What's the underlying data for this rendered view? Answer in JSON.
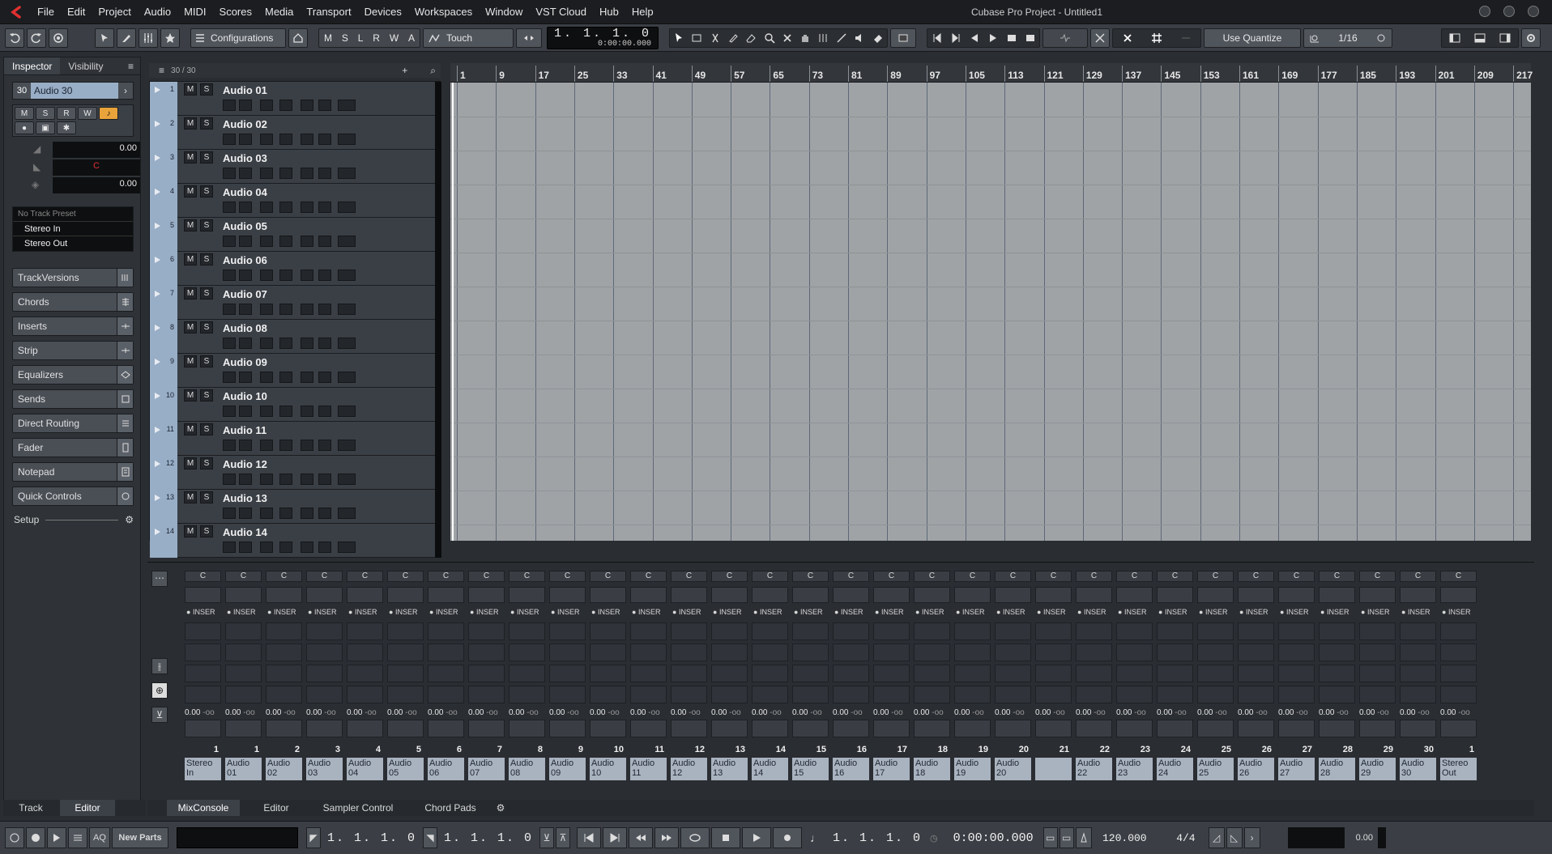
{
  "window": {
    "title": "Cubase Pro Project - Untitled1"
  },
  "menu": [
    "File",
    "Edit",
    "Project",
    "Audio",
    "MIDI",
    "Scores",
    "Media",
    "Transport",
    "Devices",
    "Workspaces",
    "Window",
    "VST Cloud",
    "Hub",
    "Help"
  ],
  "toolbar": {
    "configurations_label": "Configurations",
    "automation_mode": "Touch",
    "position_bars": "1. 1. 1.  0",
    "position_time": "0:00:00.000",
    "quantize_mode": "Use Quantize",
    "quantize_value": "1/16",
    "mute_letters": [
      "M",
      "S",
      "L",
      "R",
      "W",
      "A"
    ]
  },
  "inspector": {
    "tabs": [
      "Inspector",
      "Visibility"
    ],
    "track_number": "30",
    "track_name": "Audio 30",
    "volume": "0.00",
    "pan": "C",
    "delay": "0.00",
    "preset": "No Track Preset",
    "input": "Stereo In",
    "output": "Stereo Out",
    "sections": [
      "TrackVersions",
      "Chords",
      "Inserts",
      "Strip",
      "Equalizers",
      "Sends",
      "Direct Routing",
      "Fader",
      "Notepad",
      "Quick Controls"
    ],
    "setup_label": "Setup",
    "bottom_tabs": [
      "Track",
      "Editor"
    ]
  },
  "tracklist": {
    "count_label": "30 / 30",
    "tracks": [
      {
        "num": "1",
        "name": "Audio 01"
      },
      {
        "num": "2",
        "name": "Audio 02"
      },
      {
        "num": "3",
        "name": "Audio 03"
      },
      {
        "num": "4",
        "name": "Audio 04"
      },
      {
        "num": "5",
        "name": "Audio 05"
      },
      {
        "num": "6",
        "name": "Audio 06"
      },
      {
        "num": "7",
        "name": "Audio 07"
      },
      {
        "num": "8",
        "name": "Audio 08"
      },
      {
        "num": "9",
        "name": "Audio 09"
      },
      {
        "num": "10",
        "name": "Audio 10"
      },
      {
        "num": "11",
        "name": "Audio 11"
      },
      {
        "num": "12",
        "name": "Audio 12"
      },
      {
        "num": "13",
        "name": "Audio 13"
      },
      {
        "num": "14",
        "name": "Audio 14"
      }
    ]
  },
  "ruler": [
    "1",
    "9",
    "17",
    "25",
    "33",
    "41",
    "49",
    "57",
    "65",
    "73",
    "81",
    "89",
    "97",
    "105",
    "113",
    "121",
    "129",
    "137",
    "145",
    "153",
    "161",
    "169",
    "177",
    "185",
    "193",
    "201",
    "209",
    "217"
  ],
  "mixer": {
    "insert_label": "INSER",
    "fader_value": "0.00",
    "fader_db": "-oo",
    "pan_label": "C",
    "strips": [
      {
        "num": "1",
        "name": "Stereo In"
      },
      {
        "num": "1",
        "name": "Audio 01"
      },
      {
        "num": "2",
        "name": "Audio 02"
      },
      {
        "num": "3",
        "name": "Audio 03"
      },
      {
        "num": "4",
        "name": "Audio 04"
      },
      {
        "num": "5",
        "name": "Audio 05"
      },
      {
        "num": "6",
        "name": "Audio 06"
      },
      {
        "num": "7",
        "name": "Audio 07"
      },
      {
        "num": "8",
        "name": "Audio 08"
      },
      {
        "num": "9",
        "name": "Audio 09"
      },
      {
        "num": "10",
        "name": "Audio 10"
      },
      {
        "num": "11",
        "name": "Audio 11"
      },
      {
        "num": "12",
        "name": "Audio 12"
      },
      {
        "num": "13",
        "name": "Audio 13"
      },
      {
        "num": "14",
        "name": "Audio 14"
      },
      {
        "num": "15",
        "name": "Audio 15"
      },
      {
        "num": "16",
        "name": "Audio 16"
      },
      {
        "num": "17",
        "name": "Audio 17"
      },
      {
        "num": "18",
        "name": "Audio 18"
      },
      {
        "num": "19",
        "name": "Audio 19"
      },
      {
        "num": "20",
        "name": "Audio 20"
      },
      {
        "num": "21",
        "name": ""
      },
      {
        "num": "22",
        "name": "Audio 22"
      },
      {
        "num": "23",
        "name": "Audio 23"
      },
      {
        "num": "24",
        "name": "Audio 24"
      },
      {
        "num": "25",
        "name": "Audio 25"
      },
      {
        "num": "26",
        "name": "Audio 26"
      },
      {
        "num": "27",
        "name": "Audio 27"
      },
      {
        "num": "28",
        "name": "Audio 28"
      },
      {
        "num": "29",
        "name": "Audio 29"
      },
      {
        "num": "30",
        "name": "Audio 30"
      },
      {
        "num": "1",
        "name": "Stereo Out"
      }
    ]
  },
  "lower_tabs": [
    "MixConsole",
    "Editor",
    "Sampler Control",
    "Chord Pads"
  ],
  "transport": {
    "aq_label": "AQ",
    "new_parts": "New Parts",
    "left_locator": "1. 1. 1.  0",
    "right_locator": "1. 1. 1.  0",
    "primary_position": "1. 1. 1.  0",
    "secondary_position": "0:00:00.000",
    "tempo": "120.000",
    "signature": "4/4",
    "output_level": "0.00"
  },
  "colors": {
    "track_number_bg": "#98aec6",
    "accent": "#e8a33a",
    "arrange_bg": "#a0a3a6"
  }
}
